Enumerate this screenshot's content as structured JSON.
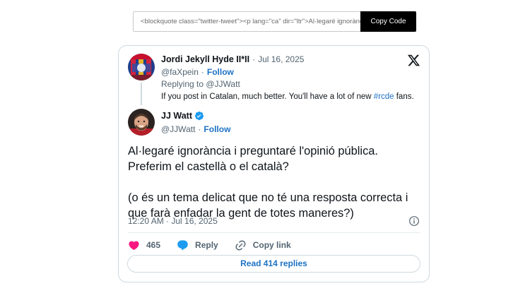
{
  "embed": {
    "code_value": "<blockquote class=\"twitter-tweet\"><p lang=\"ca\" dir=\"ltr\">Al·legaré ignorància i preguntaré l'opinió pública",
    "copy_label": "Copy Code"
  },
  "parent_tweet": {
    "name": "Jordi Jekyll Hyde II*II",
    "separator": "·",
    "date": "Jul 16, 2025",
    "handle": "@faXpein",
    "follow_label": "Follow",
    "replying_to": "Replying to @JJWatt",
    "text_before": "If you post in Catalan, much better. You'll have a lot of new ",
    "hashtag": "#rcde",
    "text_after": " fans."
  },
  "tweet": {
    "name": "JJ Watt",
    "handle": "@JJWatt",
    "follow_label": "Follow",
    "paragraph1": "Al·legaré ignorància i preguntaré l'opinió pública. Preferim el castellà o el català?",
    "paragraph2": "(o és un tema delicat que no té una resposta correcta i que farà enfadar la gent de totes maneres?)",
    "timestamp": "12:20 AM · Jul 16, 2025",
    "likes": "465",
    "reply_label": "Reply",
    "copy_link_label": "Copy link",
    "read_replies_label": "Read 414 replies"
  },
  "icons": {
    "logo": "x-logo-icon",
    "verified": "verified-badge-icon",
    "like": "heart-icon",
    "reply": "speech-bubble-icon",
    "link": "link-icon",
    "info": "info-icon"
  },
  "colors": {
    "link": "#1d72c4",
    "like": "#f91880",
    "verified": "#1d9bf0",
    "muted": "#536471",
    "border": "#cfd9de"
  }
}
